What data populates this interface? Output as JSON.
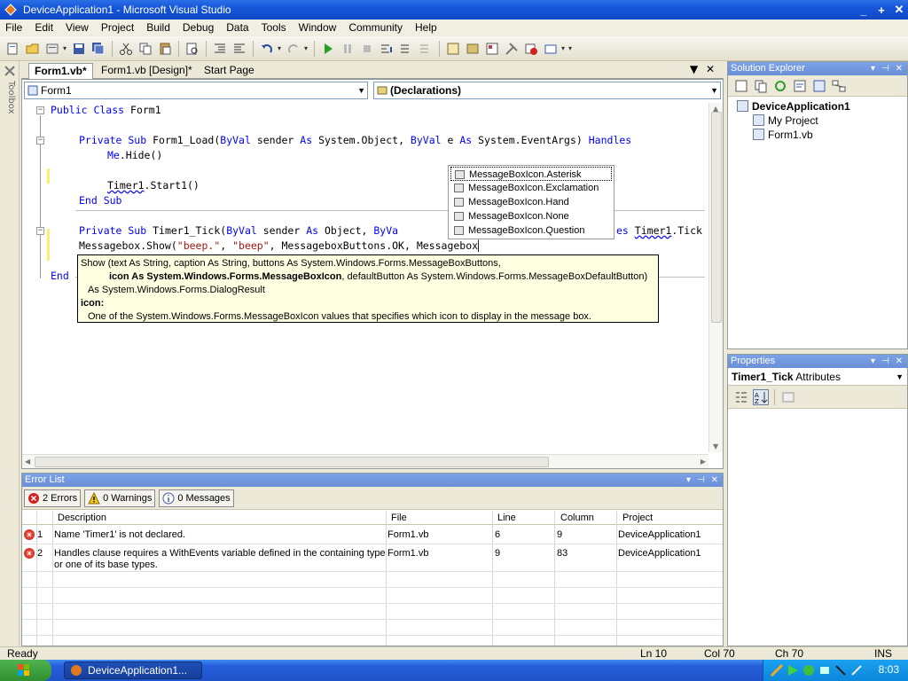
{
  "window": {
    "title": "DeviceApplication1 - Microsoft Visual Studio"
  },
  "menu": [
    "File",
    "Edit",
    "View",
    "Project",
    "Build",
    "Debug",
    "Data",
    "Tools",
    "Window",
    "Community",
    "Help"
  ],
  "toolbox_label": "Toolbox",
  "doc_tabs": [
    {
      "label": "Form1.vb*",
      "active": true
    },
    {
      "label": "Form1.vb [Design]*",
      "active": false
    },
    {
      "label": "Start Page",
      "active": false
    }
  ],
  "editor": {
    "class_combo": "Form1",
    "member_combo": "(Declarations)",
    "lines": {
      "l1_kw": "Public Class",
      "l1_rest": " Form1",
      "l3_kw1": "Private Sub",
      "l3_a": " Form1_Load(",
      "l3_kw2": "ByVal",
      "l3_b": " sender ",
      "l3_kw3": "As",
      "l3_c": " System.Object, ",
      "l3_kw4": "ByVal",
      "l3_d": " e ",
      "l3_kw5": "As",
      "l3_e": " System.EventArgs) ",
      "l3_kw6": "Handles",
      "l4_a": "Me",
      "l4_b": ".Hide()",
      "l6_sq": "Timer1",
      "l6_b": ".Start1()",
      "l7_kw": "End Sub",
      "l9_kw1": "Private Sub",
      "l9_a": " Timer1_Tick(",
      "l9_kw2": "ByVal",
      "l9_b": " sender ",
      "l9_kw3": "As",
      "l9_c": " Object, ",
      "l9_kw4": "ByVa",
      "l9_tail_kw": "es",
      "l9_tail_sq": "Timer1",
      "l9_tail_c": ".Tick",
      "l10_a": "Messagebox.Show(",
      "l10_s1": "\"beep.\"",
      "l10_b": ", ",
      "l10_s2": "\"beep\"",
      "l10_c": ", MessageboxButtons.OK, Messagebox",
      "l12_kw": "End"
    }
  },
  "intellisense": {
    "items": [
      "MessageBoxIcon.Asterisk",
      "MessageBoxIcon.Exclamation",
      "MessageBoxIcon.Hand",
      "MessageBoxIcon.None",
      "MessageBoxIcon.Question"
    ],
    "selected_index": 0
  },
  "tooltip": {
    "line1": "Show (text As String, caption As String, buttons As System.Windows.Forms.MessageBoxButtons,",
    "line2_bold": "icon As System.Windows.Forms.MessageBoxIcon",
    "line2_rest": ", defaultButton As System.Windows.Forms.MessageBoxDefaultButton)",
    "line3": "As System.Windows.Forms.DialogResult",
    "param_label": "icon:",
    "param_desc": "One of the System.Windows.Forms.MessageBoxIcon values that specifies which icon to display in the message box."
  },
  "error_list": {
    "title": "Error List",
    "filters": {
      "errors": "2 Errors",
      "warnings": "0 Warnings",
      "messages": "0 Messages"
    },
    "columns": [
      "Description",
      "File",
      "Line",
      "Column",
      "Project"
    ],
    "rows": [
      {
        "num": "1",
        "description": "Name 'Timer1' is not declared.",
        "description2": "",
        "file": "Form1.vb",
        "line": "6",
        "column": "9",
        "project": "DeviceApplication1"
      },
      {
        "num": "2",
        "description": "Handles clause requires a WithEvents variable defined in the containing type",
        "description2": "or one of its base types.",
        "file": "Form1.vb",
        "line": "9",
        "column": "83",
        "project": "DeviceApplication1"
      }
    ]
  },
  "solution_explorer": {
    "title": "Solution Explorer",
    "root": "DeviceApplication1",
    "children": [
      "My Project",
      "Form1.vb"
    ]
  },
  "properties": {
    "title": "Properties",
    "object": "Timer1_Tick",
    "object_type": "Attributes"
  },
  "status": {
    "text": "Ready",
    "ln": "Ln 10",
    "col": "Col 70",
    "ch": "Ch 70",
    "mode": "INS"
  },
  "taskbar": {
    "item": "DeviceApplication1...",
    "clock": "8:03"
  },
  "colors": {
    "keyword": "#0000ff",
    "string": "#a31515",
    "tooltip_bg": "#ffffe1",
    "titlebar": "#1556d8"
  }
}
